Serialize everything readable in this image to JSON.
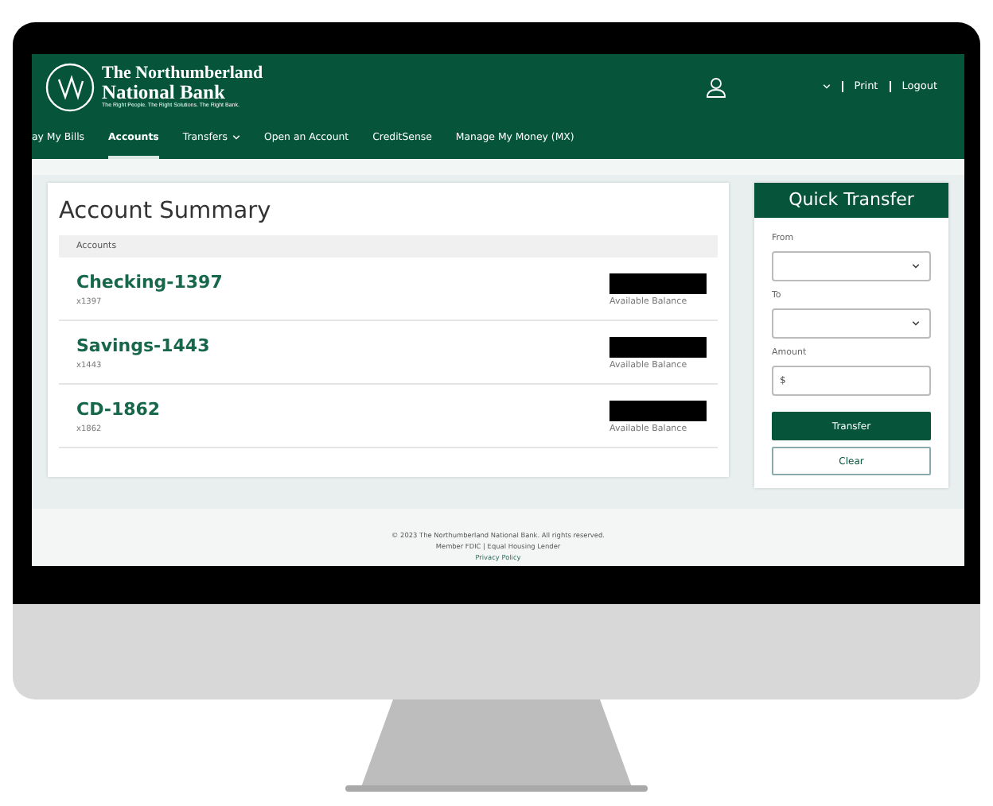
{
  "bank": {
    "name_line1": "The Northumberland",
    "name_line2": "National Bank",
    "tagline": "The Right People. The Right Solutions. The Right Bank."
  },
  "header_links": [
    "Print",
    "Logout"
  ],
  "nav": [
    {
      "label": "ay My Bills",
      "selected": false,
      "dropdown": false
    },
    {
      "label": "Accounts",
      "selected": true,
      "dropdown": false
    },
    {
      "label": "Transfers",
      "selected": false,
      "dropdown": true
    },
    {
      "label": "Open an Account",
      "selected": false,
      "dropdown": false
    },
    {
      "label": "CreditSense",
      "selected": false,
      "dropdown": false
    },
    {
      "label": "Manage My Money (MX)",
      "selected": false,
      "dropdown": false
    }
  ],
  "summary": {
    "title": "Account Summary",
    "section": "Accounts",
    "accounts": [
      {
        "name": "Checking-1397",
        "number": "x1397",
        "balance_label": "Available Balance"
      },
      {
        "name": "Savings-1443",
        "number": "x1443",
        "balance_label": "Available Balance"
      },
      {
        "name": "CD-1862",
        "number": "x1862",
        "balance_label": "Available Balance"
      }
    ]
  },
  "quick_transfer": {
    "title": "Quick Transfer",
    "fields": [
      {
        "label": "From",
        "kind": "select"
      },
      {
        "label": "To",
        "kind": "select"
      },
      {
        "label": "Amount",
        "kind": "text",
        "value": "$"
      }
    ],
    "buttons": [
      {
        "label": "Transfer",
        "kind": "primary"
      },
      {
        "label": "Clear",
        "kind": "secondary"
      }
    ]
  },
  "footer": {
    "copyright": "© 2023 The Northumberland National Bank. All rights reserved.",
    "member": "Member FDIC | Equal Housing Lender",
    "link": "Privacy Policy"
  }
}
